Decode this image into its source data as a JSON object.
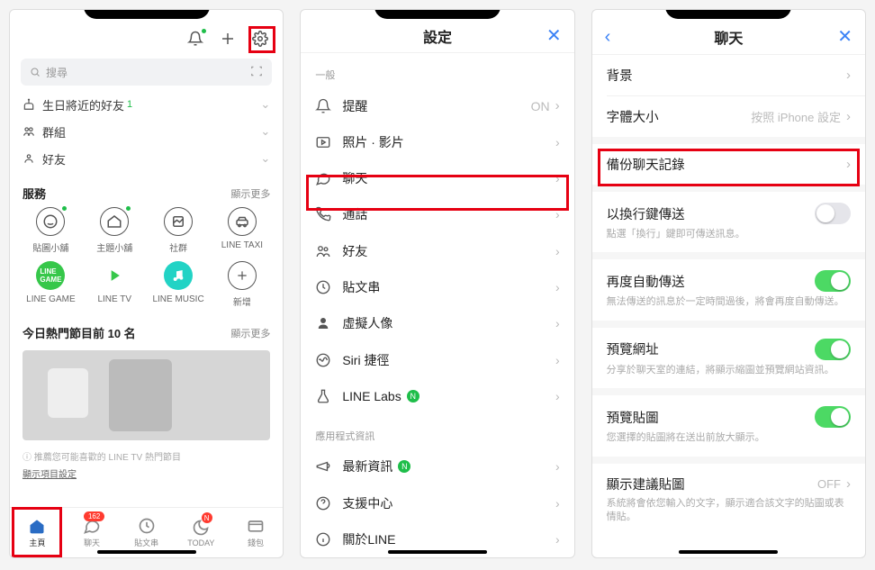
{
  "screen1": {
    "search_placeholder": "搜尋",
    "rows": {
      "birthday": "生日將近的好友",
      "birthday_count": "1",
      "groups": "群組",
      "friends": "好友"
    },
    "services_head": "服務",
    "show_more": "顯示更多",
    "services": [
      {
        "label": "貼圖小舖"
      },
      {
        "label": "主題小舖"
      },
      {
        "label": "社群"
      },
      {
        "label": "LINE TAXI"
      },
      {
        "label": "LINE GAME"
      },
      {
        "label": "LINE TV"
      },
      {
        "label": "LINE MUSIC"
      },
      {
        "label": "新增"
      }
    ],
    "trending_title": "今日熱門節目前 10 名",
    "caption": "ⓘ 推薦您可能喜歡的 LINE TV 熱門節目",
    "caption_link": "顯示項目設定",
    "tabs": [
      {
        "label": "主頁"
      },
      {
        "label": "聊天",
        "badge": "162"
      },
      {
        "label": "貼文串"
      },
      {
        "label": "TODAY",
        "n": "N"
      },
      {
        "label": "錢包"
      }
    ]
  },
  "screen2": {
    "title": "設定",
    "group_general": "一般",
    "group_app": "應用程式資訊",
    "items": {
      "remind": "提醒",
      "remind_val": "ON",
      "photo": "照片 · 影片",
      "chat": "聊天",
      "call": "通話",
      "friends": "好友",
      "timeline": "貼文串",
      "avatar": "虛擬人像",
      "siri": "Siri 捷徑",
      "labs": "LINE Labs",
      "news": "最新資訊",
      "support": "支援中心",
      "about": "關於LINE"
    }
  },
  "screen3": {
    "title": "聊天",
    "items": {
      "bg": "背景",
      "fontsize": "字體大小",
      "fontsize_val": "按照 iPhone 設定",
      "backup": "備份聊天記錄",
      "enter_send": "以換行鍵傳送",
      "enter_send_sub": "點選「換行」鍵即可傳送訊息。",
      "resend": "再度自動傳送",
      "resend_sub": "無法傳送的訊息於一定時間過後，將會再度自動傳送。",
      "preview_url": "預覽網址",
      "preview_url_sub": "分享於聊天室的連結，將顯示縮圖並預覽網站資訊。",
      "preview_sticker": "預覽貼圖",
      "preview_sticker_sub": "您選擇的貼圖將在送出前放大顯示。",
      "suggest": "顯示建議貼圖",
      "suggest_val": "OFF",
      "suggest_sub": "系統將會依您輸入的文字，顯示適合該文字的貼圖或表情貼。"
    }
  }
}
